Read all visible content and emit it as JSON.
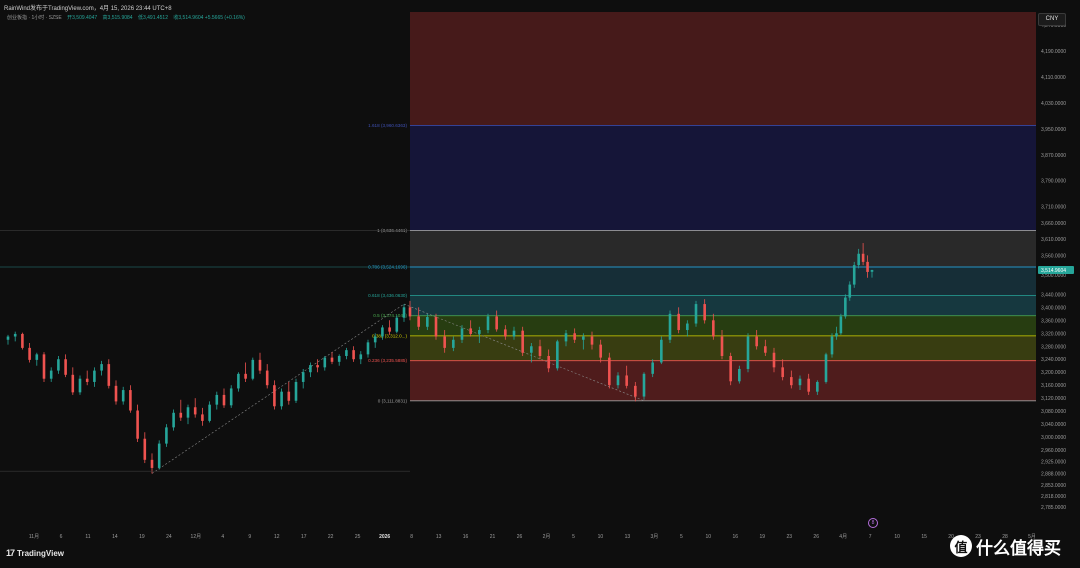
{
  "header": {
    "title": "RainWind发布于TradingView.com，4月 15, 2026 23:44 UTC+8"
  },
  "legend": {
    "symbol": "创业板指 · 1小时 · SZSE",
    "open": "开3,509.4047",
    "high": "高3,515.9084",
    "low": "低3,491.4512",
    "close": "收3,514.9604 +5.5665 (+0.16%)"
  },
  "currency": "CNY",
  "logo": {
    "mark": "17",
    "text": "TradingView"
  },
  "watermark": {
    "badge": "值",
    "text": "什么值得买"
  },
  "event_marker": "8",
  "colors": {
    "up": "#26a69a",
    "down": "#ef5350",
    "background": "#0e0e0e",
    "band_red": "#5a1f1f",
    "band_orange": "#5c3a12",
    "band_green": "#2c4512",
    "band_teal": "#184048",
    "band_grey": "#2e2e2e",
    "band_blue": "#16163f",
    "last_price_tag": "#26a69a"
  },
  "chart_data": {
    "type": "candlestick",
    "title": "",
    "y_axis": {
      "ylim": [
        2760,
        4310
      ],
      "scale": "linear",
      "position": "right",
      "ticks": [
        "4,270.0000",
        "4,190.0000",
        "4,110.0000",
        "4,030.0000",
        "3,950.0000",
        "3,870.0000",
        "3,790.0000",
        "3,710.0000",
        "3,660.0000",
        "3,610.0000",
        "3,560.0000",
        "3,500.0000",
        "3,440.0000",
        "3,400.0000",
        "3,360.0000",
        "3,320.0000",
        "3,280.0000",
        "3,240.0000",
        "3,200.0000",
        "3,160.0000",
        "3,120.0000",
        "3,080.0000",
        "3,040.0000",
        "3,000.0000",
        "2,960.0000",
        "2,925.0000",
        "2,888.0000",
        "2,853.0000",
        "2,818.0000",
        "2,785.0000"
      ],
      "tick_values": [
        4270,
        4190,
        4110,
        4030,
        3950,
        3870,
        3790,
        3710,
        3660,
        3610,
        3560,
        3500,
        3440,
        3400,
        3360,
        3320,
        3280,
        3240,
        3200,
        3160,
        3120,
        3080,
        3040,
        3000,
        2960,
        2925,
        2888,
        2853,
        2818,
        2785
      ]
    },
    "x_axis": {
      "ticks": [
        "11月",
        "6",
        "11",
        "14",
        "19",
        "24",
        "12月",
        "4",
        "9",
        "12",
        "17",
        "22",
        "25",
        "2026",
        "8",
        "13",
        "16",
        "21",
        "26",
        "2月",
        "5",
        "10",
        "13",
        "3月",
        "5",
        "10",
        "16",
        "19",
        "23",
        "26",
        "4月",
        "7",
        "10",
        "15",
        "20",
        "23",
        "28",
        "5月"
      ]
    },
    "last_price": {
      "label": "3,514.9604",
      "value": 3514.9604
    },
    "fibonacci": {
      "levels": [
        {
          "ratio": 0,
          "price": 3111.8831,
          "label": "0 (3,111.8831)",
          "color": "#9e9e9e"
        },
        {
          "ratio": 0.236,
          "price": 3235.5885,
          "label": "0.236 (3,235.5885)",
          "color": "#ef5350"
        },
        {
          "ratio": 0.382,
          "price": 3312.0,
          "label": "0.382 (3,312.0...)",
          "color": "#d4d400"
        },
        {
          "ratio": 0.5,
          "price": 3374.1048,
          "label": "0.5 (3,374.1048)",
          "color": "#4caf50"
        },
        {
          "ratio": 0.618,
          "price": 3436.063,
          "label": "0.618 (3,436.0630)",
          "color": "#26a69a"
        },
        {
          "ratio": 0.786,
          "price": 3524.1696,
          "label": "0.786 (3,524.1696)",
          "color": "#29b6f6"
        },
        {
          "ratio": 1,
          "price": 3636.4461,
          "label": "1 (3,636.4461)",
          "color": "#9e9e9e"
        },
        {
          "ratio": 1.618,
          "price": 3960.6363,
          "label": "1.618 (3,960.6363)",
          "color": "#3f51b5"
        }
      ]
    },
    "series": [
      {
        "name": "",
        "candles": [
          [
            3300,
            3315,
            3285,
            3310
          ],
          [
            3310,
            3325,
            3295,
            3318
          ],
          [
            3318,
            3322,
            3270,
            3275
          ],
          [
            3275,
            3290,
            3230,
            3238
          ],
          [
            3238,
            3260,
            3220,
            3255
          ],
          [
            3255,
            3262,
            3170,
            3180
          ],
          [
            3180,
            3215,
            3170,
            3205
          ],
          [
            3205,
            3250,
            3195,
            3240
          ],
          [
            3240,
            3255,
            3185,
            3192
          ],
          [
            3192,
            3215,
            3130,
            3138
          ],
          [
            3138,
            3190,
            3130,
            3180
          ],
          [
            3180,
            3205,
            3160,
            3170
          ],
          [
            3170,
            3215,
            3155,
            3205
          ],
          [
            3205,
            3235,
            3190,
            3225
          ],
          [
            3225,
            3240,
            3150,
            3158
          ],
          [
            3158,
            3175,
            3100,
            3110
          ],
          [
            3110,
            3155,
            3100,
            3145
          ],
          [
            3145,
            3160,
            3075,
            3082
          ],
          [
            3082,
            3100,
            2985,
            2995
          ],
          [
            2995,
            3015,
            2920,
            2930
          ],
          [
            2930,
            2950,
            2888,
            2905
          ],
          [
            2905,
            2990,
            2900,
            2980
          ],
          [
            2980,
            3040,
            2970,
            3030
          ],
          [
            3030,
            3085,
            3020,
            3075
          ],
          [
            3075,
            3115,
            3050,
            3060
          ],
          [
            3060,
            3100,
            3040,
            3092
          ],
          [
            3092,
            3120,
            3060,
            3070
          ],
          [
            3070,
            3090,
            3035,
            3050
          ],
          [
            3050,
            3110,
            3045,
            3100
          ],
          [
            3100,
            3140,
            3085,
            3130
          ],
          [
            3130,
            3150,
            3090,
            3098
          ],
          [
            3098,
            3160,
            3090,
            3150
          ],
          [
            3150,
            3200,
            3140,
            3195
          ],
          [
            3195,
            3230,
            3170,
            3180
          ],
          [
            3180,
            3245,
            3175,
            3238
          ],
          [
            3238,
            3260,
            3195,
            3205
          ],
          [
            3205,
            3225,
            3150,
            3160
          ],
          [
            3160,
            3175,
            3085,
            3095
          ],
          [
            3095,
            3150,
            3085,
            3140
          ],
          [
            3140,
            3170,
            3100,
            3112
          ],
          [
            3112,
            3180,
            3105,
            3170
          ],
          [
            3170,
            3210,
            3150,
            3200
          ],
          [
            3200,
            3230,
            3185,
            3222
          ],
          [
            3222,
            3240,
            3200,
            3215
          ],
          [
            3215,
            3250,
            3205,
            3245
          ],
          [
            3245,
            3262,
            3225,
            3232
          ],
          [
            3232,
            3255,
            3220,
            3250
          ],
          [
            3250,
            3275,
            3240,
            3268
          ],
          [
            3268,
            3280,
            3232,
            3240
          ],
          [
            3240,
            3265,
            3225,
            3255
          ],
          [
            3255,
            3300,
            3245,
            3292
          ],
          [
            3292,
            3320,
            3275,
            3310
          ],
          [
            3310,
            3345,
            3300,
            3338
          ],
          [
            3338,
            3360,
            3315,
            3325
          ],
          [
            3325,
            3375,
            3320,
            3368
          ],
          [
            3368,
            3410,
            3355,
            3400
          ],
          [
            3400,
            3420,
            3360,
            3372
          ],
          [
            3372,
            3400,
            3330,
            3340
          ],
          [
            3340,
            3380,
            3330,
            3370
          ],
          [
            3370,
            3380,
            3300,
            3310
          ],
          [
            3310,
            3330,
            3260,
            3275
          ],
          [
            3275,
            3310,
            3265,
            3300
          ],
          [
            3300,
            3345,
            3290,
            3335
          ],
          [
            3335,
            3360,
            3310,
            3318
          ],
          [
            3318,
            3340,
            3290,
            3330
          ],
          [
            3330,
            3380,
            3320,
            3372
          ],
          [
            3372,
            3390,
            3325,
            3332
          ],
          [
            3332,
            3345,
            3300,
            3310
          ],
          [
            3310,
            3340,
            3300,
            3328
          ],
          [
            3328,
            3340,
            3250,
            3260
          ],
          [
            3260,
            3290,
            3230,
            3280
          ],
          [
            3280,
            3300,
            3240,
            3250
          ],
          [
            3250,
            3270,
            3200,
            3212
          ],
          [
            3212,
            3300,
            3205,
            3295
          ],
          [
            3295,
            3330,
            3280,
            3320
          ],
          [
            3320,
            3335,
            3290,
            3300
          ],
          [
            3300,
            3320,
            3270,
            3310
          ],
          [
            3310,
            3325,
            3270,
            3285
          ],
          [
            3285,
            3300,
            3230,
            3245
          ],
          [
            3245,
            3260,
            3150,
            3160
          ],
          [
            3160,
            3200,
            3150,
            3190
          ],
          [
            3190,
            3220,
            3150,
            3158
          ],
          [
            3158,
            3170,
            3110,
            3125
          ],
          [
            3125,
            3200,
            3115,
            3195
          ],
          [
            3195,
            3240,
            3185,
            3230
          ],
          [
            3230,
            3310,
            3225,
            3300
          ],
          [
            3300,
            3390,
            3290,
            3380
          ],
          [
            3380,
            3400,
            3320,
            3330
          ],
          [
            3330,
            3360,
            3310,
            3350
          ],
          [
            3350,
            3420,
            3340,
            3410
          ],
          [
            3410,
            3425,
            3350,
            3360
          ],
          [
            3360,
            3380,
            3300,
            3310
          ],
          [
            3310,
            3330,
            3240,
            3250
          ],
          [
            3250,
            3260,
            3160,
            3172
          ],
          [
            3172,
            3220,
            3165,
            3210
          ],
          [
            3210,
            3320,
            3200,
            3310
          ],
          [
            3310,
            3330,
            3270,
            3280
          ],
          [
            3280,
            3300,
            3250,
            3260
          ],
          [
            3260,
            3275,
            3200,
            3215
          ],
          [
            3215,
            3240,
            3175,
            3185
          ],
          [
            3185,
            3205,
            3150,
            3160
          ],
          [
            3160,
            3190,
            3145,
            3180
          ],
          [
            3180,
            3195,
            3130,
            3140
          ],
          [
            3140,
            3175,
            3130,
            3170
          ],
          [
            3170,
            3260,
            3165,
            3255
          ],
          [
            3255,
            3320,
            3245,
            3310
          ],
          [
            3310,
            3340,
            3300,
            3320
          ],
          [
            3320,
            3380,
            3315,
            3372
          ],
          [
            3372,
            3440,
            3365,
            3430
          ],
          [
            3430,
            3480,
            3420,
            3470
          ],
          [
            3470,
            3540,
            3460,
            3530
          ],
          [
            3530,
            3580,
            3520,
            3565
          ],
          [
            3565,
            3598,
            3530,
            3540
          ],
          [
            3540,
            3560,
            3491,
            3509
          ],
          [
            3509.4047,
            3515.9084,
            3491.4512,
            3514.9604
          ]
        ]
      }
    ]
  }
}
